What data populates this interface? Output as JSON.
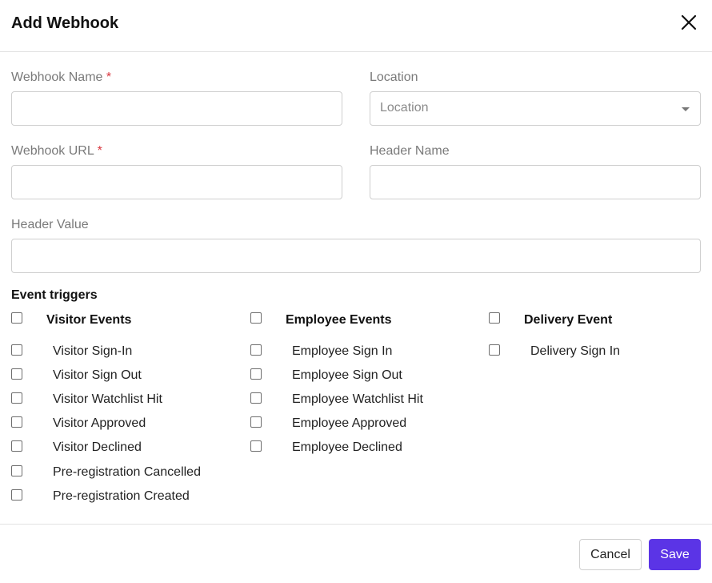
{
  "dialog": {
    "title": "Add Webhook"
  },
  "form": {
    "webhook_name": {
      "label": "Webhook Name",
      "required_mark": "*",
      "value": ""
    },
    "location": {
      "label": "Location",
      "placeholder": "Location"
    },
    "webhook_url": {
      "label": "Webhook URL",
      "required_mark": "*",
      "value": ""
    },
    "header_name": {
      "label": "Header Name",
      "value": ""
    },
    "header_value": {
      "label": "Header Value",
      "value": ""
    }
  },
  "event_triggers": {
    "title": "Event triggers",
    "groups": [
      {
        "label": "Visitor Events",
        "checked": false,
        "items": [
          {
            "label": "Visitor Sign-In",
            "checked": false
          },
          {
            "label": "Visitor Sign Out",
            "checked": false
          },
          {
            "label": "Visitor Watchlist Hit",
            "checked": false
          },
          {
            "label": "Visitor Approved",
            "checked": false
          },
          {
            "label": "Visitor Declined",
            "checked": false
          },
          {
            "label": "Pre-registration Cancelled",
            "checked": false
          },
          {
            "label": "Pre-registration Created",
            "checked": false
          }
        ]
      },
      {
        "label": "Employee Events",
        "checked": false,
        "items": [
          {
            "label": "Employee Sign In",
            "checked": false
          },
          {
            "label": "Employee Sign Out",
            "checked": false
          },
          {
            "label": "Employee Watchlist Hit",
            "checked": false
          },
          {
            "label": "Employee Approved",
            "checked": false
          },
          {
            "label": "Employee Declined",
            "checked": false
          }
        ]
      },
      {
        "label": "Delivery Event",
        "checked": false,
        "items": [
          {
            "label": "Delivery Sign In",
            "checked": false
          }
        ]
      }
    ]
  },
  "footer": {
    "cancel_label": "Cancel",
    "save_label": "Save"
  },
  "colors": {
    "primary": "#5b34e6",
    "required": "#d9363e",
    "border": "#cfcfcf"
  },
  "icons": {
    "close": "close-icon",
    "dropdown": "chevron-down-icon"
  }
}
